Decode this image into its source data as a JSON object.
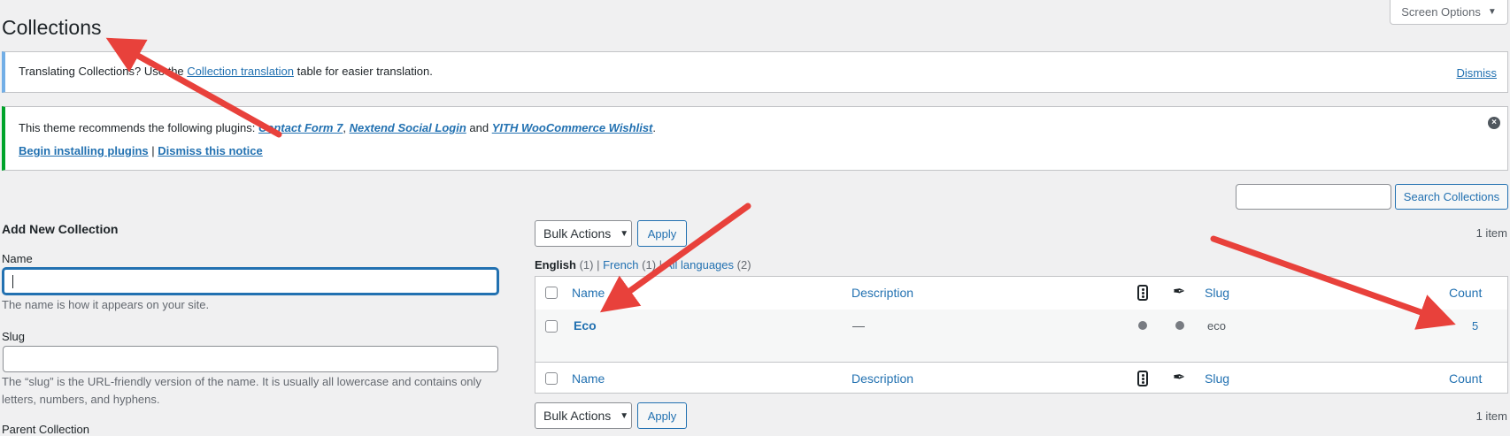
{
  "page": {
    "title": "Collections"
  },
  "screen_options": {
    "label": "Screen Options"
  },
  "notice_translation": {
    "prefix": "Translating Collections? Use the",
    "link": "Collection translation",
    "suffix": "table for easier translation.",
    "dismiss": "Dismiss"
  },
  "notice_plugins": {
    "prefix": "This theme recommends the following plugins:",
    "plugin1": "Contact Form 7",
    "sep1": ",",
    "plugin2": "Nextend Social Login",
    "and": "and",
    "plugin3": "YITH WooCommerce Wishlist",
    "end": ".",
    "begin": "Begin installing plugins",
    "bar": "|",
    "dismiss_notice": "Dismiss this notice"
  },
  "search": {
    "button": "Search Collections",
    "value": ""
  },
  "form": {
    "title": "Add New Collection",
    "name_label": "Name",
    "name_desc": "The name is how it appears on your site.",
    "slug_label": "Slug",
    "slug_desc": "The “slug” is the URL-friendly version of the name. It is usually all lowercase and contains only letters, numbers, and hyphens.",
    "parent_label": "Parent Collection"
  },
  "bulk": {
    "label": "Bulk Actions",
    "apply": "Apply"
  },
  "item_count": "1 item",
  "languages": [
    {
      "label": "English",
      "count": "(1)"
    },
    {
      "label": "French",
      "count": "(1)"
    },
    {
      "label": "All languages",
      "count": "(2)"
    }
  ],
  "table": {
    "columns": {
      "name": "Name",
      "description": "Description",
      "slug": "Slug",
      "count": "Count"
    },
    "rows": [
      {
        "name": "Eco",
        "description": "—",
        "slug": "eco",
        "count": "5"
      }
    ]
  },
  "colors": {
    "annotation_arrow": "#e8413b",
    "accent": "#2271b1"
  }
}
